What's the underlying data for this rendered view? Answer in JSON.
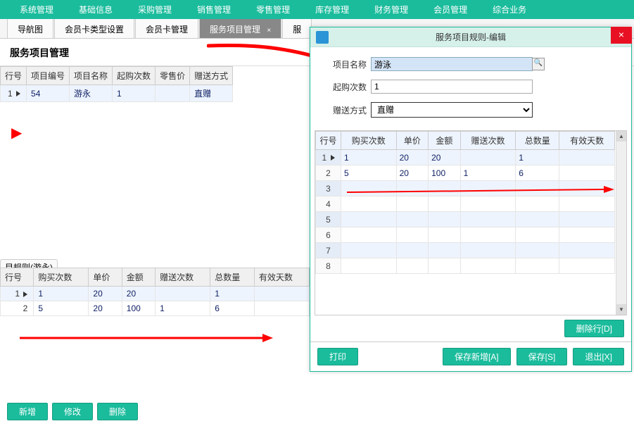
{
  "menubar": {
    "items": [
      "系统管理",
      "基础信息",
      "采购管理",
      "销售管理",
      "零售管理",
      "库存管理",
      "财务管理",
      "会员管理",
      "综合业务"
    ]
  },
  "tabs": [
    {
      "label": "导航图"
    },
    {
      "label": "会员卡类型设置"
    },
    {
      "label": "会员卡管理"
    },
    {
      "label": "服务项目管理",
      "active": true,
      "closable": true
    },
    {
      "label": "服"
    }
  ],
  "page_title": "服务项目管理",
  "left_table": {
    "headers": [
      "行号",
      "项目编号",
      "项目名称",
      "起购次数",
      "零售价",
      "赠送方式"
    ],
    "rows": [
      {
        "row": "1",
        "code": "54",
        "name": "游永",
        "min": "1",
        "price": "",
        "mode": "直赠"
      }
    ]
  },
  "rules_section_title": "目规则(游永)",
  "rules_table": {
    "headers": [
      "行号",
      "购买次数",
      "单价",
      "金额",
      "赠送次数",
      "总数量",
      "有效天数"
    ],
    "rows": [
      {
        "row": "1",
        "buy": "1",
        "price": "20",
        "amount": "20",
        "gift": "",
        "total": "1",
        "days": ""
      },
      {
        "row": "2",
        "buy": "5",
        "price": "20",
        "amount": "100",
        "gift": "1",
        "total": "6",
        "days": ""
      }
    ]
  },
  "bottom_buttons": {
    "add": "新增",
    "edit": "修改",
    "del": "删除"
  },
  "dialog": {
    "title": "服务项目规则-编辑",
    "form": {
      "name_label": "项目名称",
      "name_value": "游泳",
      "min_label": "起购次数",
      "min_value": "1",
      "mode_label": "赠送方式",
      "mode_value": "直赠"
    },
    "grid": {
      "headers": [
        "行号",
        "购买次数",
        "单价",
        "金额",
        "赠送次数",
        "总数量",
        "有效天数"
      ],
      "rows": [
        {
          "row": "1",
          "buy": "1",
          "price": "20",
          "amount": "20",
          "gift": "",
          "total": "1",
          "days": ""
        },
        {
          "row": "2",
          "buy": "5",
          "price": "20",
          "amount": "100",
          "gift": "1",
          "total": "6",
          "days": ""
        },
        {
          "row": "3"
        },
        {
          "row": "4"
        },
        {
          "row": "5"
        },
        {
          "row": "6"
        },
        {
          "row": "7"
        },
        {
          "row": "8"
        }
      ]
    },
    "delrow_btn": "删除行[D]",
    "buttons": {
      "print": "打印",
      "save_new": "保存新增[A]",
      "save": "保存[S]",
      "exit": "退出[X]"
    }
  }
}
